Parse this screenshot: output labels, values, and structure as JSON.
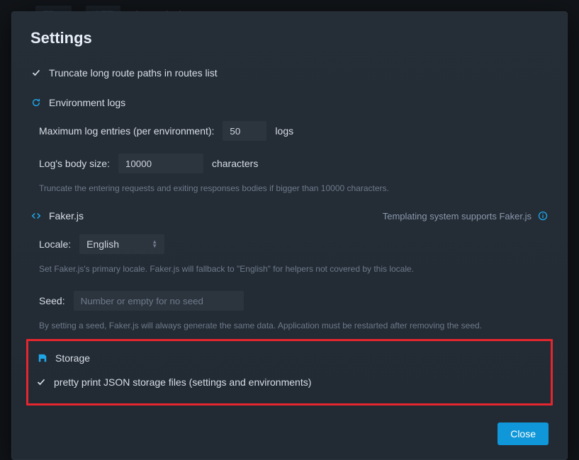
{
  "background": {
    "filter": "Filter",
    "method": "GET",
    "slash": "/",
    "endpoint": "endpoint"
  },
  "modal": {
    "title": "Settings",
    "truncate_routes_label": "Truncate long route paths in routes list",
    "env_logs": {
      "section_label": "Environment logs",
      "max_entries_label": "Maximum log entries (per environment):",
      "max_entries_value": "50",
      "max_entries_suffix": "logs",
      "body_size_label": "Log's body size:",
      "body_size_value": "10000",
      "body_size_suffix": "characters",
      "body_size_help": "Truncate the entering requests and exiting responses bodies if bigger than 10000 characters."
    },
    "faker": {
      "section_label": "Faker.js",
      "supports_label": "Templating system supports Faker.js",
      "locale_label": "Locale:",
      "locale_value": "English",
      "locale_help": "Set Faker.js's primary locale. Faker.js will fallback to \"English\" for helpers not covered by this locale.",
      "seed_label": "Seed:",
      "seed_placeholder": "Number or empty for no seed",
      "seed_help": "By setting a seed, Faker.js will always generate the same data. Application must be restarted after removing the seed."
    },
    "storage": {
      "section_label": "Storage",
      "pretty_print_label": "pretty print JSON storage files (settings and environments)"
    },
    "close_label": "Close"
  }
}
